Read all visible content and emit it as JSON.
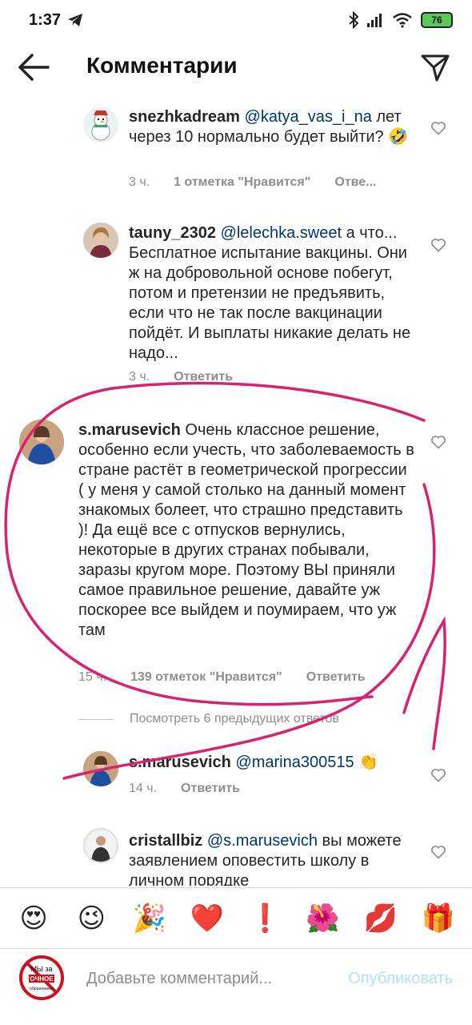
{
  "status_bar": {
    "time": "1:37",
    "battery": "76"
  },
  "header": {
    "title": "Комментарии"
  },
  "comments": [
    {
      "username": "snezhkadream",
      "mention": "@katya_vas_i_na",
      "text": "лет через 10 нормально будет выйти? 🤣",
      "time": "3 ч.",
      "likes": "1 отметка \"Нравится\"",
      "reply": "Отве..."
    },
    {
      "username": "tauny_2302",
      "mention": "@lelechka.sweet",
      "text": "а что... Бесплатное испытание вакцины. Они ж на добровольной основе побегут, потом и претензии не предъявить, если что не так после вакцинации пойдёт. И выплаты никакие делать не надо...",
      "time": "3 ч.",
      "reply": "Ответить"
    },
    {
      "username": "s.marusevich",
      "text": "Очень классное решение, особенно если учесть, что заболеваемость в стране растёт в геометрической прогрессии ( у меня у самой столько на данный момент знакомых болеет, что страшно представить )! Да ещё все с отпусков вернулись, некоторые в других странах побывали, заразы кругом море. Поэтому ВЫ приняли самое правильное решение, давайте уж поскорее все выйдем и поумираем, что уж там",
      "time": "15 ч.",
      "likes": "139 отметок \"Нравится\"",
      "reply": "Ответить"
    },
    {
      "username": "s.marusevich",
      "mention": "@marina300515",
      "text": "👏",
      "time": "14 ч.",
      "reply": "Ответить"
    },
    {
      "username": "cristallbiz",
      "mention": "@s.marusevich",
      "text": "вы можете заявлением оповестить школу в личном порядке"
    }
  ],
  "view_replies": "Посмотреть 6 предыдущих ответов",
  "emojis": [
    "😍",
    "😉",
    "🎉",
    "❤️",
    "❗",
    "🌺",
    "💋",
    "🎁"
  ],
  "input": {
    "placeholder": "Добавьте комментарий...",
    "publish_label": "Опубликовать"
  },
  "self_avatar_text": {
    "line1": "МЫ за",
    "line2": "ОЧНОЕ",
    "line3": "образование"
  },
  "colors": {
    "mention": "#00376b",
    "annotation": "#d6246e",
    "publish": "#b2dffc"
  }
}
